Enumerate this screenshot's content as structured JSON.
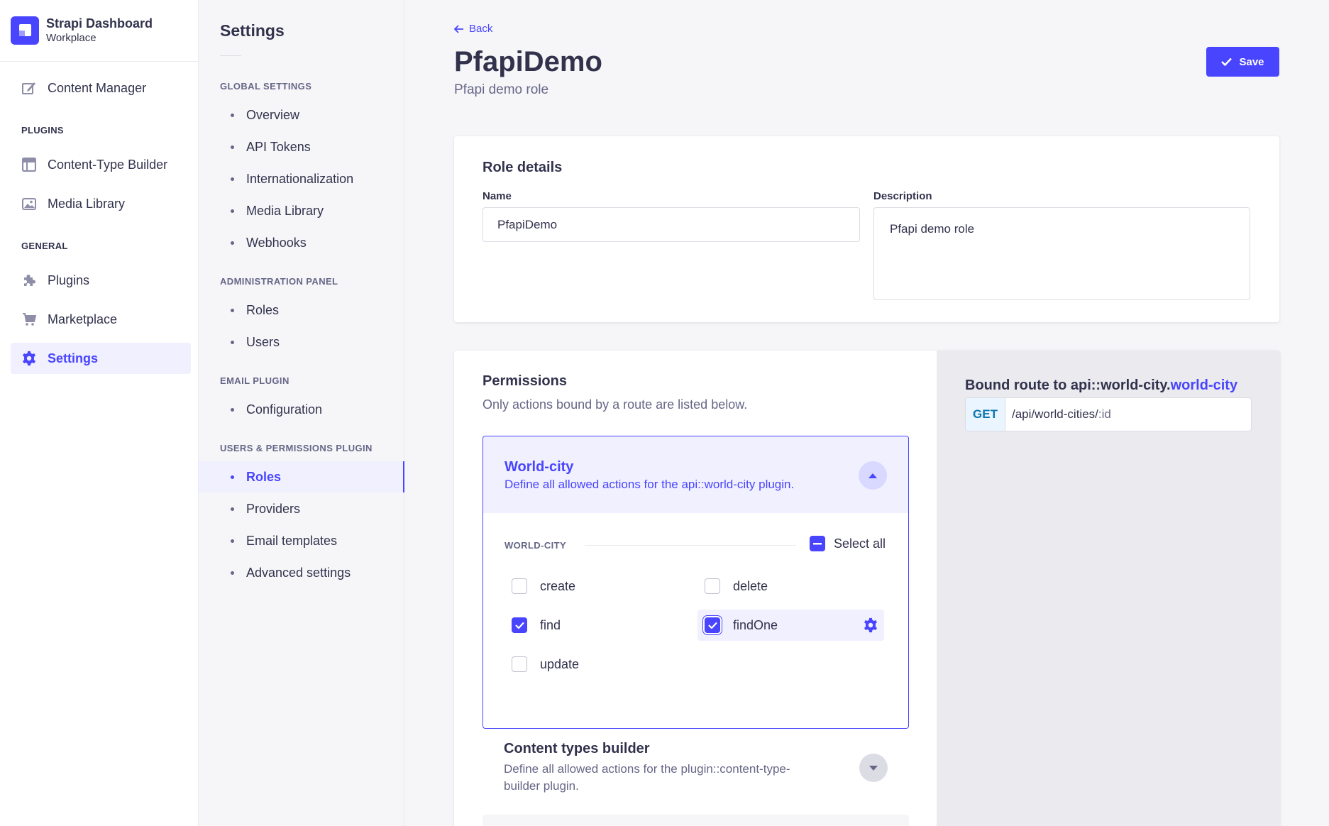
{
  "brand": {
    "title": "Strapi Dashboard",
    "subtitle": "Workplace"
  },
  "mainnav": {
    "content_manager": "Content Manager",
    "plugins_label": "PLUGINS",
    "content_type_builder": "Content-Type Builder",
    "media_library": "Media Library",
    "general_label": "GENERAL",
    "plugins": "Plugins",
    "marketplace": "Marketplace",
    "settings": "Settings"
  },
  "subnav": {
    "title": "Settings",
    "global_label": "GLOBAL SETTINGS",
    "global_items": [
      "Overview",
      "API Tokens",
      "Internationalization",
      "Media Library",
      "Webhooks"
    ],
    "admin_label": "ADMINISTRATION PANEL",
    "admin_items": [
      "Roles",
      "Users"
    ],
    "email_label": "EMAIL PLUGIN",
    "email_items": [
      "Configuration"
    ],
    "up_label": "USERS & PERMISSIONS PLUGIN",
    "up_items": [
      "Roles",
      "Providers",
      "Email templates",
      "Advanced settings"
    ]
  },
  "header": {
    "back": "Back",
    "title": "PfapiDemo",
    "subtitle": "Pfapi demo role",
    "save": "Save"
  },
  "role_details": {
    "title": "Role details",
    "name_label": "Name",
    "name_value": "PfapiDemo",
    "description_label": "Description",
    "description_value": "Pfapi demo role"
  },
  "permissions": {
    "title": "Permissions",
    "subtitle": "Only actions bound by a route are listed below.",
    "accordion": {
      "title": "World-city",
      "description": "Define all allowed actions for the api::world-city plugin.",
      "group_label": "WORLD-CITY",
      "select_all": "Select all",
      "actions": [
        {
          "label": "create",
          "checked": false
        },
        {
          "label": "delete",
          "checked": false
        },
        {
          "label": "find",
          "checked": true
        },
        {
          "label": "findOne",
          "checked": true
        },
        {
          "label": "update",
          "checked": false
        }
      ]
    },
    "accordion2": {
      "title": "Content types builder",
      "description_line1": "Define all allowed actions for the plugin::content-type-",
      "description_line2": "builder plugin."
    }
  },
  "route": {
    "title_prefix": "Bound route to api::world-city.",
    "title_accent": "world-city",
    "method": "GET",
    "path": "/api/world-cities/",
    "param": ":id"
  },
  "colors": {
    "primary": "#4945ff",
    "primary_light": "#f0f0ff",
    "text": "#32324d",
    "muted": "#666687"
  }
}
